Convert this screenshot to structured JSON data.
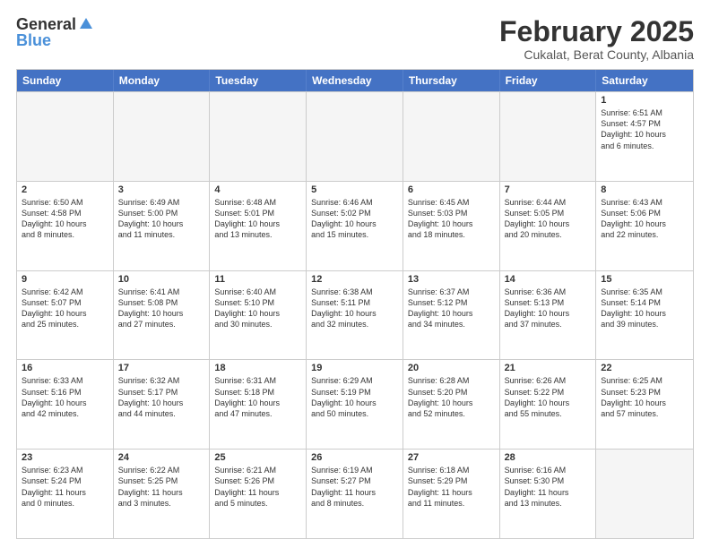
{
  "logo": {
    "general": "General",
    "blue": "Blue"
  },
  "title": {
    "month_year": "February 2025",
    "location": "Cukalat, Berat County, Albania"
  },
  "header": {
    "days": [
      "Sunday",
      "Monday",
      "Tuesday",
      "Wednesday",
      "Thursday",
      "Friday",
      "Saturday"
    ]
  },
  "weeks": [
    [
      {
        "day": "",
        "empty": true
      },
      {
        "day": "",
        "empty": true
      },
      {
        "day": "",
        "empty": true
      },
      {
        "day": "",
        "empty": true
      },
      {
        "day": "",
        "empty": true
      },
      {
        "day": "",
        "empty": true
      },
      {
        "day": "1",
        "text": "Sunrise: 6:51 AM\nSunset: 4:57 PM\nDaylight: 10 hours\nand 6 minutes."
      }
    ],
    [
      {
        "day": "2",
        "text": "Sunrise: 6:50 AM\nSunset: 4:58 PM\nDaylight: 10 hours\nand 8 minutes."
      },
      {
        "day": "3",
        "text": "Sunrise: 6:49 AM\nSunset: 5:00 PM\nDaylight: 10 hours\nand 11 minutes."
      },
      {
        "day": "4",
        "text": "Sunrise: 6:48 AM\nSunset: 5:01 PM\nDaylight: 10 hours\nand 13 minutes."
      },
      {
        "day": "5",
        "text": "Sunrise: 6:46 AM\nSunset: 5:02 PM\nDaylight: 10 hours\nand 15 minutes."
      },
      {
        "day": "6",
        "text": "Sunrise: 6:45 AM\nSunset: 5:03 PM\nDaylight: 10 hours\nand 18 minutes."
      },
      {
        "day": "7",
        "text": "Sunrise: 6:44 AM\nSunset: 5:05 PM\nDaylight: 10 hours\nand 20 minutes."
      },
      {
        "day": "8",
        "text": "Sunrise: 6:43 AM\nSunset: 5:06 PM\nDaylight: 10 hours\nand 22 minutes."
      }
    ],
    [
      {
        "day": "9",
        "text": "Sunrise: 6:42 AM\nSunset: 5:07 PM\nDaylight: 10 hours\nand 25 minutes."
      },
      {
        "day": "10",
        "text": "Sunrise: 6:41 AM\nSunset: 5:08 PM\nDaylight: 10 hours\nand 27 minutes."
      },
      {
        "day": "11",
        "text": "Sunrise: 6:40 AM\nSunset: 5:10 PM\nDaylight: 10 hours\nand 30 minutes."
      },
      {
        "day": "12",
        "text": "Sunrise: 6:38 AM\nSunset: 5:11 PM\nDaylight: 10 hours\nand 32 minutes."
      },
      {
        "day": "13",
        "text": "Sunrise: 6:37 AM\nSunset: 5:12 PM\nDaylight: 10 hours\nand 34 minutes."
      },
      {
        "day": "14",
        "text": "Sunrise: 6:36 AM\nSunset: 5:13 PM\nDaylight: 10 hours\nand 37 minutes."
      },
      {
        "day": "15",
        "text": "Sunrise: 6:35 AM\nSunset: 5:14 PM\nDaylight: 10 hours\nand 39 minutes."
      }
    ],
    [
      {
        "day": "16",
        "text": "Sunrise: 6:33 AM\nSunset: 5:16 PM\nDaylight: 10 hours\nand 42 minutes."
      },
      {
        "day": "17",
        "text": "Sunrise: 6:32 AM\nSunset: 5:17 PM\nDaylight: 10 hours\nand 44 minutes."
      },
      {
        "day": "18",
        "text": "Sunrise: 6:31 AM\nSunset: 5:18 PM\nDaylight: 10 hours\nand 47 minutes."
      },
      {
        "day": "19",
        "text": "Sunrise: 6:29 AM\nSunset: 5:19 PM\nDaylight: 10 hours\nand 50 minutes."
      },
      {
        "day": "20",
        "text": "Sunrise: 6:28 AM\nSunset: 5:20 PM\nDaylight: 10 hours\nand 52 minutes."
      },
      {
        "day": "21",
        "text": "Sunrise: 6:26 AM\nSunset: 5:22 PM\nDaylight: 10 hours\nand 55 minutes."
      },
      {
        "day": "22",
        "text": "Sunrise: 6:25 AM\nSunset: 5:23 PM\nDaylight: 10 hours\nand 57 minutes."
      }
    ],
    [
      {
        "day": "23",
        "text": "Sunrise: 6:23 AM\nSunset: 5:24 PM\nDaylight: 11 hours\nand 0 minutes."
      },
      {
        "day": "24",
        "text": "Sunrise: 6:22 AM\nSunset: 5:25 PM\nDaylight: 11 hours\nand 3 minutes."
      },
      {
        "day": "25",
        "text": "Sunrise: 6:21 AM\nSunset: 5:26 PM\nDaylight: 11 hours\nand 5 minutes."
      },
      {
        "day": "26",
        "text": "Sunrise: 6:19 AM\nSunset: 5:27 PM\nDaylight: 11 hours\nand 8 minutes."
      },
      {
        "day": "27",
        "text": "Sunrise: 6:18 AM\nSunset: 5:29 PM\nDaylight: 11 hours\nand 11 minutes."
      },
      {
        "day": "28",
        "text": "Sunrise: 6:16 AM\nSunset: 5:30 PM\nDaylight: 11 hours\nand 13 minutes."
      },
      {
        "day": "",
        "empty": true
      }
    ]
  ]
}
